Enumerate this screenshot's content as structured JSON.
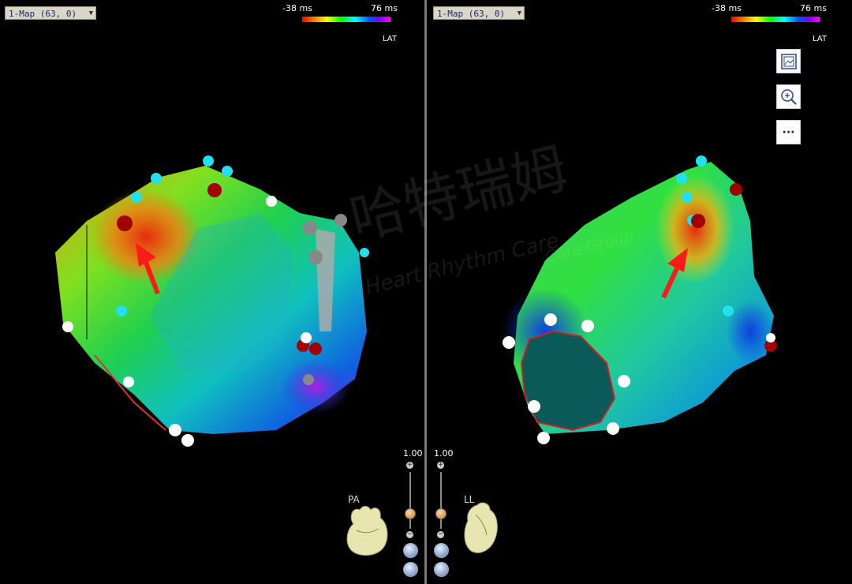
{
  "left": {
    "map_selector": "1-Map (63, 0)",
    "scale_min": "-38 ms",
    "scale_max": "76 ms",
    "map_type": "LAT",
    "orientation": "PA",
    "zoom": "1.00"
  },
  "right": {
    "map_selector": "1-Map (63, 0)",
    "scale_min": "-38 ms",
    "scale_max": "76 ms",
    "map_type": "LAT",
    "orientation": "LL",
    "zoom": "1.00",
    "tools": {
      "snapshot_icon": "image-frame-icon",
      "zoom_icon": "magnifier-plus-icon",
      "more_label": "···"
    }
  },
  "watermark": {
    "cn": "哈特瑞姆",
    "en": "Heart Rhythm Care",
    "en_tail": "Care Group"
  },
  "colors": {
    "map_red": "#e83010",
    "tag_cyan": "#22e0f0",
    "tag_white": "#ffffff",
    "tag_darkred": "#a00000",
    "arrow": "#ff1a1a"
  }
}
